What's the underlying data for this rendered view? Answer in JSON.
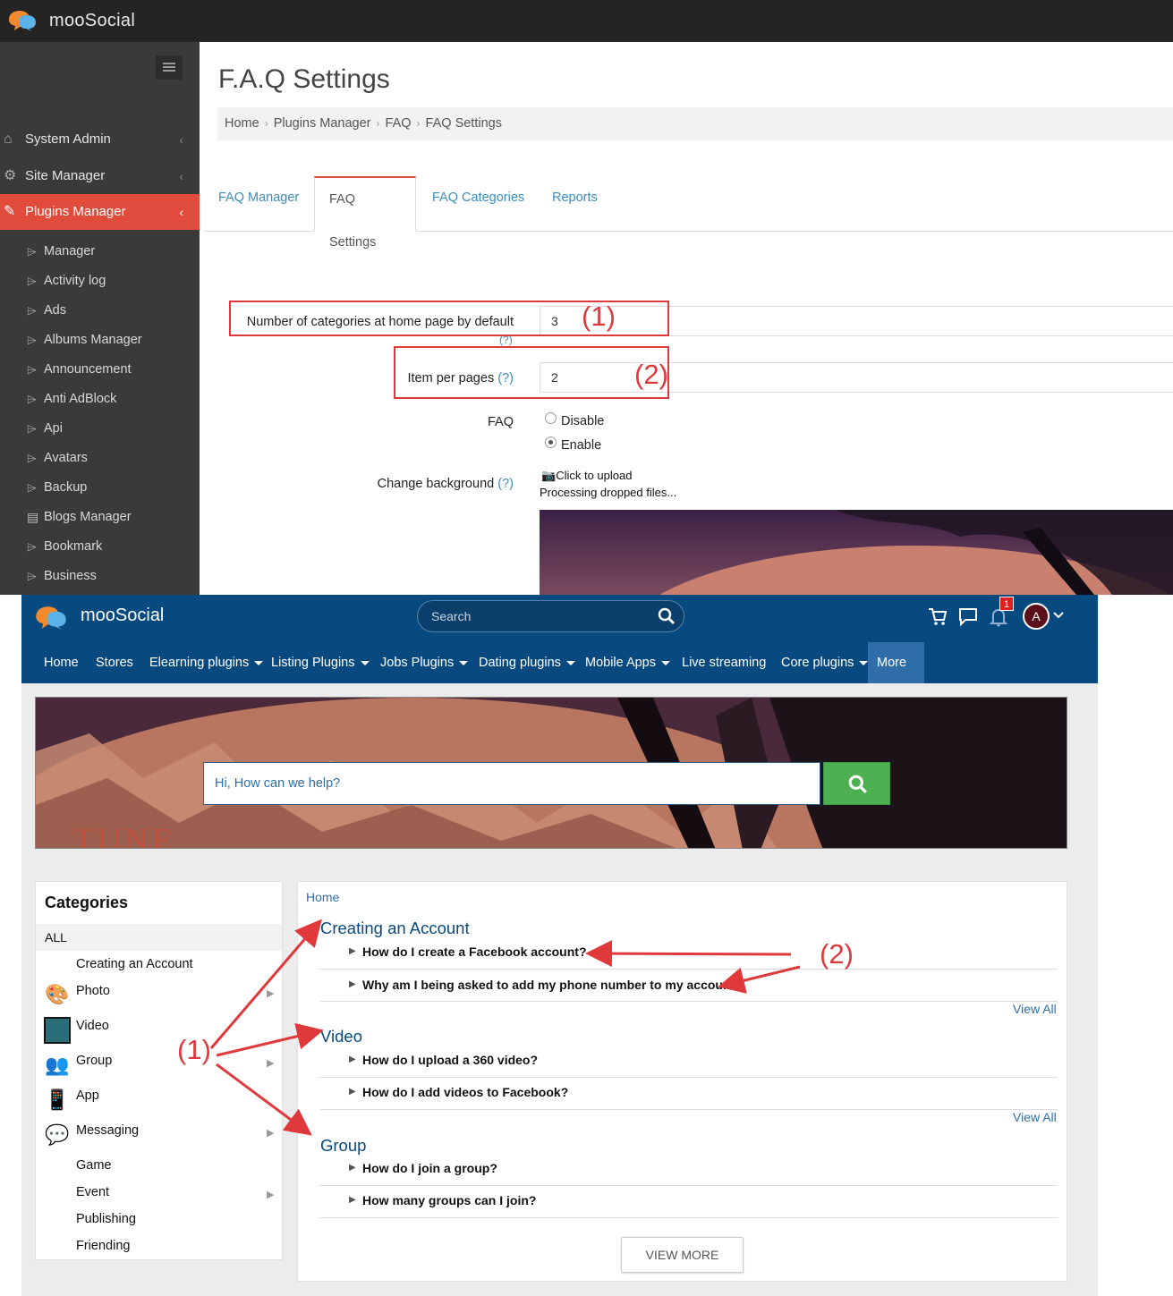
{
  "admin": {
    "brand": "mooSocial",
    "sidebar": {
      "main": [
        {
          "label": "System Admin"
        },
        {
          "label": "Site Manager"
        },
        {
          "label": "Plugins Manager"
        }
      ],
      "sub": [
        "Manager",
        "Activity log",
        "Ads",
        "Albums Manager",
        "Announcement",
        "Anti AdBlock",
        "Api",
        "Avatars",
        "Backup",
        "Blogs Manager",
        "Bookmark",
        "Business"
      ]
    },
    "page_title": "F.A.Q Settings",
    "breadcrumb": [
      "Home",
      "Plugins Manager",
      "FAQ",
      "FAQ Settings"
    ],
    "tabs": [
      "FAQ Manager",
      "FAQ Settings",
      "FAQ Categories",
      "Reports"
    ],
    "active_tab": "FAQ Settings",
    "form": {
      "categories_label": "Number of categories at home page by default",
      "categories_value": "3",
      "help": "?",
      "items_label": "Item per pages",
      "items_value": "2",
      "faq_label": "FAQ",
      "faq_options": [
        "Disable",
        "Enable"
      ],
      "faq_selected": "Enable",
      "background_label": "Change background",
      "upload_text": "Click to upload",
      "processing_text": "Processing dropped files..."
    },
    "annotations": {
      "one": "(1)",
      "two": "(2)"
    }
  },
  "site": {
    "brand": "mooSocial",
    "search_placeholder": "Search",
    "notification_count": "1",
    "avatar_letter": "A",
    "nav": [
      "Home",
      "Stores",
      "Elearning plugins",
      "Listing Plugins",
      "Jobs Plugins",
      "Dating plugins",
      "Mobile Apps",
      "Live streaming",
      "Core plugins",
      "More"
    ],
    "hero_placeholder": "Hi, How can we help?",
    "hero_art_text": "TUNE",
    "categories": {
      "title": "Categories",
      "all": "ALL",
      "items": [
        "Creating an Account",
        "Photo",
        "Video",
        "Group",
        "App",
        "Messaging",
        "Game",
        "Event",
        "Publishing",
        "Friending"
      ]
    },
    "faq": {
      "breadcrumb": "Home",
      "sections": [
        {
          "title": "Creating an Account",
          "questions": [
            "How do I create a Facebook account?",
            "Why am I being asked to add my phone number to my account?"
          ]
        },
        {
          "title": "Video",
          "questions": [
            "How do I upload a 360 video?",
            "How do I add videos to Facebook?"
          ]
        },
        {
          "title": "Group",
          "questions": [
            "How do I join a group?",
            "How many groups can I join?"
          ]
        }
      ],
      "view_all": "View All",
      "view_more": "VIEW MORE"
    },
    "annotations": {
      "one": "(1)",
      "two": "(2)"
    }
  },
  "colors": {
    "accent_red": "#e14b3b",
    "site_blue": "#074a80",
    "link_blue": "#3c8dbc",
    "annotation_red": "#e0393c",
    "search_green": "#4cb050"
  }
}
